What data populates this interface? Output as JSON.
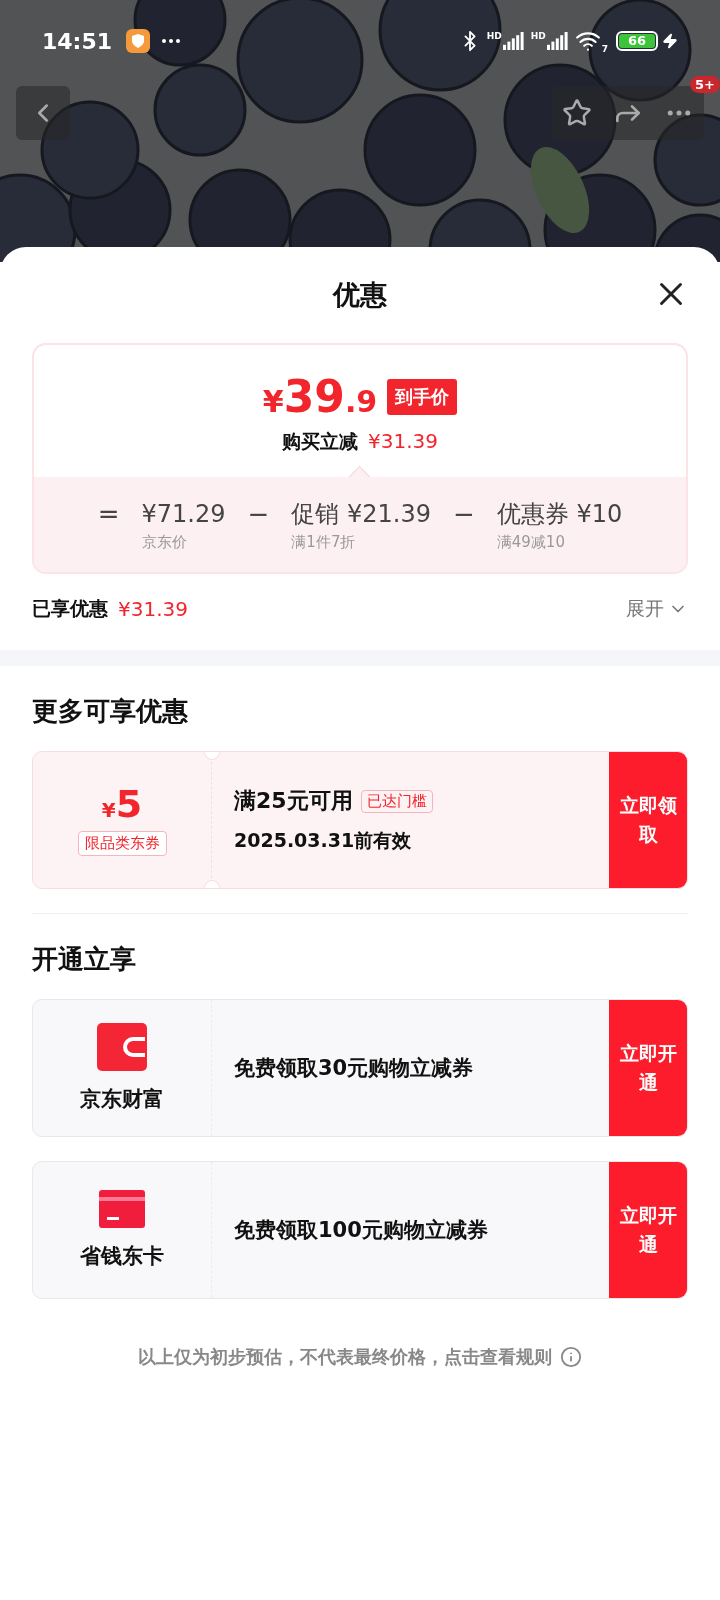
{
  "status_bar": {
    "time": "14:51",
    "signal_labels": [
      "HD",
      "HD"
    ],
    "wifi_label": "7",
    "battery": "66"
  },
  "nav": {
    "cart_badge": "5+"
  },
  "sheet": {
    "title": "优惠"
  },
  "price": {
    "currency": "¥",
    "integer": "39",
    "decimal": ".9",
    "tag": "到手价",
    "saving_label": "购买立减",
    "saving": "¥31.39"
  },
  "breakdown": {
    "equals": "=",
    "items": [
      {
        "value": "¥71.29",
        "note": "京东价"
      },
      {
        "operator": "−",
        "label": "促销",
        "value": "¥21.39",
        "note": "满1件7折"
      },
      {
        "operator": "−",
        "label": "优惠券",
        "value": "¥10",
        "note": "满49减10"
      }
    ]
  },
  "enjoyed": {
    "label": "已享优惠",
    "value": "¥31.39",
    "toggle": "展开",
    "expanded": false
  },
  "more_offers": {
    "title": "更多可享优惠",
    "coupons": [
      {
        "currency": "¥",
        "amount": "5",
        "scope": "限品类东券",
        "condition": "满25元可用",
        "badge": "已达门槛",
        "validity": "2025.03.31前有效",
        "action": "立即领取"
      }
    ]
  },
  "memberships": {
    "title": "开通立享",
    "items": [
      {
        "kind": "wallet",
        "name": "京东财富",
        "benefit": "免费领取30元购物立减券",
        "action": "立即开通"
      },
      {
        "kind": "card",
        "name": "省钱东卡",
        "benefit": "免费领取100元购物立减券",
        "action": "立即开通"
      }
    ]
  },
  "footer": {
    "note": "以上仅为初步预估，不代表最终价格，点击查看规则"
  }
}
